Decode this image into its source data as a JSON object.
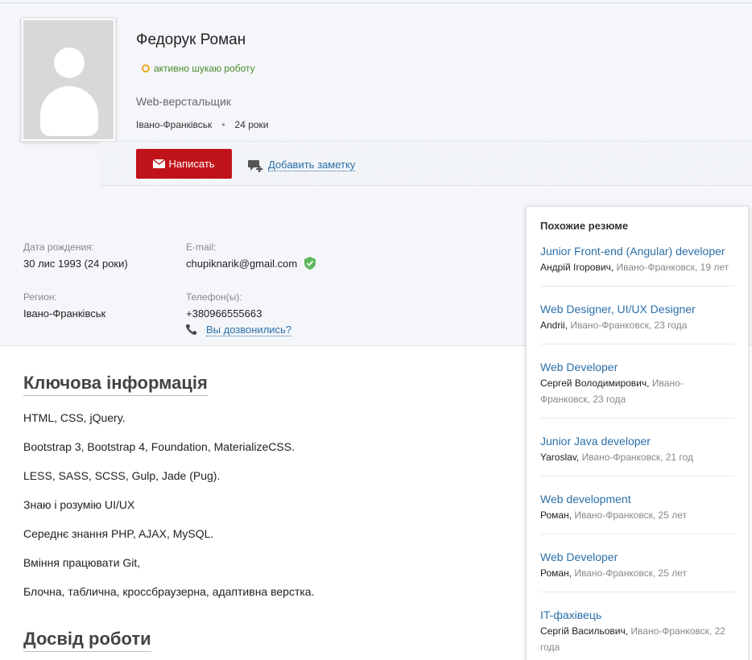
{
  "profile": {
    "name": "Федорук Роман",
    "status": "активно шукаю роботу",
    "position": "Web-верстальщик",
    "city": "Івано-Франківськ",
    "separator": "•",
    "age": "24 роки"
  },
  "actions": {
    "write_label": "Написать",
    "note_label": "Добавить заметку"
  },
  "details": {
    "birth_label": "Дата рождения:",
    "birth_value": "30 лис 1993 (24 роки)",
    "email_label": "E-mail:",
    "email_value": "chupiknarik@gmail.com",
    "region_label": "Регион:",
    "region_value": "Івано-Франківськ",
    "phone_label": "Телефон(ы):",
    "phone_value": "+380966555663",
    "call_label": "Вы дозвонились?"
  },
  "key_info": {
    "title": "Ключова інформація",
    "lines": [
      "HTML, CSS, jQuery.",
      "Bootstrap 3, Bootstrap 4, Foundation, MaterializeCSS.",
      "LESS, SASS, SCSS, Gulp, Jade (Pug).",
      "Знаю і розумію UI/UX",
      "Середнє знання PHP, AJAX, MySQL.",
      "Вміння працювати Git,",
      "Блочна, таблична, кроссбраузерна, адаптивна верстка."
    ]
  },
  "experience": {
    "title": "Досвід роботи"
  },
  "similar": {
    "title": "Похожие резюме",
    "items": [
      {
        "title": "Junior Front-end (Angular) developer",
        "person": "Андрій Ігорович,",
        "details": "Ивано-Франковск, 19 лет"
      },
      {
        "title": "Web Designer, UI/UX Designer",
        "person": "Andrii,",
        "details": "Ивано-Франковск, 23 года"
      },
      {
        "title": "Web Developer",
        "person": "Сергей Володимирович,",
        "details": "Ивано-Франковск, 23 года"
      },
      {
        "title": "Junior Java developer",
        "person": "Yaroslav,",
        "details": "Ивано-Франковск, 21 год"
      },
      {
        "title": "Web development",
        "person": "Роман,",
        "details": "Ивано-Франковск, 25 лет"
      },
      {
        "title": "Web Developer",
        "person": "Роман,",
        "details": "Ивано-Франковск, 25 лет"
      },
      {
        "title": "IT-фахівець",
        "person": "Сергій Васильович,",
        "details": "Ивано-Франковск, 22 года"
      }
    ]
  },
  "colors": {
    "accent_red": "#c1141a",
    "link_blue": "#2b6fa8",
    "status_green": "#4a8a2e",
    "status_dot": "#f0a91e",
    "verified_green": "#5cb85c"
  }
}
